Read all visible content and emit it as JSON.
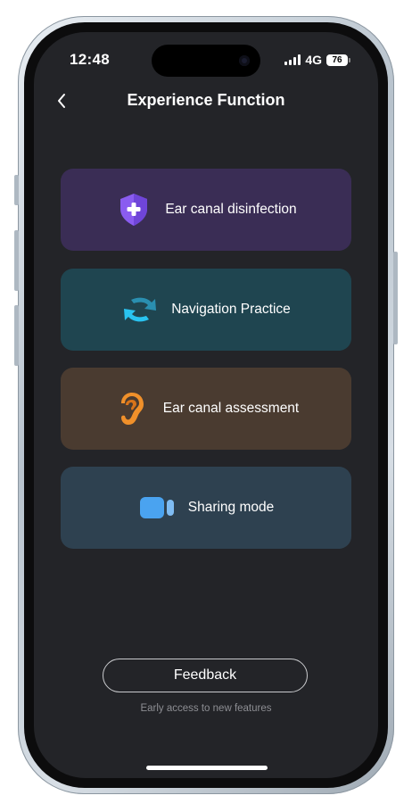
{
  "status_bar": {
    "time": "12:48",
    "network": "4G",
    "battery": "76"
  },
  "header": {
    "back_icon": "chevron-left-icon",
    "title": "Experience Function"
  },
  "cards": [
    {
      "label": "Ear canal disinfection",
      "icon": "shield-plus-icon",
      "bg": "#3a2d55",
      "accent": "#8a5cf0"
    },
    {
      "label": "Navigation Practice",
      "icon": "sync-arrows-icon",
      "bg": "#1f4550",
      "accent": "#29b6e6"
    },
    {
      "label": "Ear canal assessment",
      "icon": "ear-icon",
      "bg": "#4a3b30",
      "accent": "#f0902a"
    },
    {
      "label": "Sharing mode",
      "icon": "video-camera-icon",
      "bg": "#2e4150",
      "accent": "#4aa3f0"
    }
  ],
  "footer": {
    "feedback_label": "Feedback",
    "subcaption": "Early access to new features"
  },
  "colors": {
    "screen_bg": "#232428",
    "text": "#ffffff",
    "muted_text": "#8d8e93"
  }
}
